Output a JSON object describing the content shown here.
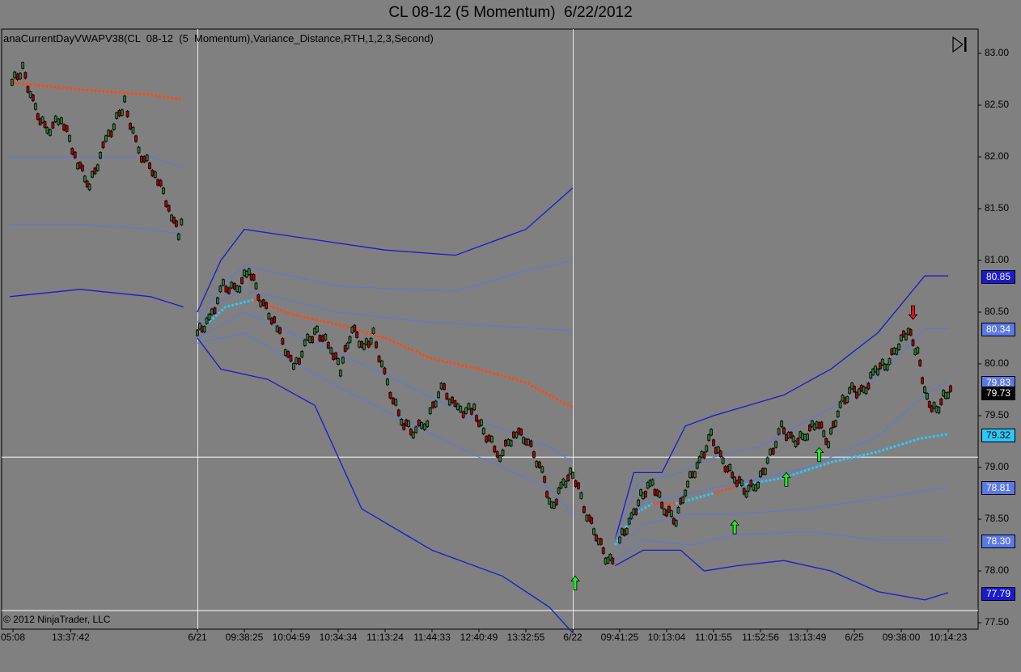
{
  "title": "CL 08-12 (5 Momentum)  6/22/2012",
  "indicator_label": "anaCurrentDayVWAPV38(CL  08-12  (5  Momentum),Variance_Distance,RTH,1,2,3,Second)",
  "copyright": "© 2012 NinjaTrader, LLC",
  "toolbar": {
    "play_icon": "skip-to-end-icon"
  },
  "colors": {
    "background": "#808080",
    "band_outer": "#1a1ad0",
    "band_inner": "#5a78e6",
    "vwap_down": "#ff4a10",
    "vwap_up": "#2ac8ff",
    "candle_up": "#2e7d32",
    "candle_down": "#b00000",
    "arrow_up": "#22ee22",
    "arrow_down": "#dd1111"
  },
  "chart_data": {
    "type": "candlestick",
    "symbol": "CL 08-12",
    "yaxis": {
      "ticks": [
        "83.00",
        "82.50",
        "82.00",
        "81.50",
        "81.00",
        "80.50",
        "80.00",
        "79.50",
        "79.00",
        "78.50",
        "78.00",
        "77.50"
      ],
      "range": [
        77.5,
        83.2
      ]
    },
    "xaxis": {
      "ticks": [
        "05:08",
        "13:37:42",
        "6/21",
        "09:38:25",
        "10:04:59",
        "10:34:34",
        "11:13:24",
        "11:44:33",
        "12:40:49",
        "13:32:55",
        "6/22",
        "09:41:25",
        "10:13:04",
        "11:01:55",
        "11:52:56",
        "13:13:49",
        "6/25",
        "09:38:00",
        "10:14:23"
      ],
      "tick_pos": [
        0.0,
        1.3,
        4.0,
        5.0,
        6.0,
        7.0,
        8.0,
        9.0,
        10.0,
        11.0,
        12.0,
        13.0,
        14.0,
        15.0,
        16.0,
        17.0,
        18.0,
        19.0,
        20.0
      ]
    },
    "price_badges": [
      {
        "label": "80.85",
        "value": 80.85,
        "style": "outer"
      },
      {
        "label": "80.34",
        "value": 80.34,
        "style": "inner"
      },
      {
        "label": "79.83",
        "value": 79.83,
        "style": "inner"
      },
      {
        "label": "79.73",
        "value": 79.73,
        "style": "last"
      },
      {
        "label": "79.32",
        "value": 79.32,
        "style": "vwap"
      },
      {
        "label": "78.81",
        "value": 78.81,
        "style": "inner"
      },
      {
        "label": "78.30",
        "value": 78.3,
        "style": "inner"
      },
      {
        "label": "77.79",
        "value": 77.79,
        "style": "outer"
      }
    ],
    "crosshair": {
      "x": 12.0,
      "y": 79.1
    },
    "session_dividers": [
      4.0,
      12.0
    ],
    "price_path": [
      {
        "segment": 1,
        "points": [
          [
            0.05,
            82.72
          ],
          [
            0.28,
            82.85
          ],
          [
            0.55,
            82.45
          ],
          [
            0.8,
            82.25
          ],
          [
            1.1,
            82.38
          ],
          [
            1.45,
            81.95
          ],
          [
            1.7,
            81.72
          ],
          [
            2.05,
            82.15
          ],
          [
            2.45,
            82.52
          ],
          [
            2.75,
            82.05
          ],
          [
            3.1,
            81.85
          ],
          [
            3.45,
            81.45
          ],
          [
            3.6,
            81.25
          ],
          [
            3.72,
            81.42
          ]
        ]
      },
      {
        "segment": 2,
        "points": [
          [
            4.0,
            80.3
          ],
          [
            4.25,
            80.42
          ],
          [
            4.55,
            80.75
          ],
          [
            4.85,
            80.72
          ],
          [
            5.1,
            80.92
          ],
          [
            5.35,
            80.62
          ],
          [
            5.7,
            80.35
          ],
          [
            6.05,
            79.95
          ],
          [
            6.35,
            80.22
          ],
          [
            6.55,
            80.32
          ],
          [
            6.85,
            80.15
          ],
          [
            7.05,
            79.95
          ],
          [
            7.3,
            80.35
          ],
          [
            7.55,
            80.15
          ],
          [
            7.75,
            80.28
          ],
          [
            8.05,
            79.8
          ],
          [
            8.35,
            79.45
          ],
          [
            8.6,
            79.35
          ],
          [
            8.9,
            79.45
          ],
          [
            9.2,
            79.78
          ],
          [
            9.55,
            79.55
          ],
          [
            9.9,
            79.55
          ],
          [
            10.1,
            79.35
          ],
          [
            10.45,
            79.12
          ],
          [
            10.8,
            79.35
          ],
          [
            11.05,
            79.25
          ],
          [
            11.35,
            78.95
          ],
          [
            11.55,
            78.6
          ],
          [
            11.8,
            78.85
          ],
          [
            12.0,
            78.95
          ],
          [
            12.3,
            78.55
          ],
          [
            12.55,
            78.3
          ],
          [
            12.75,
            78.08
          ],
          [
            12.9,
            78.15
          ]
        ]
      },
      {
        "segment": 3,
        "points": [
          [
            13.0,
            78.3
          ],
          [
            13.25,
            78.5
          ],
          [
            13.45,
            78.72
          ],
          [
            13.7,
            78.85
          ],
          [
            13.95,
            78.6
          ],
          [
            14.2,
            78.5
          ],
          [
            14.45,
            78.85
          ],
          [
            14.7,
            79.05
          ],
          [
            14.95,
            79.3
          ],
          [
            15.2,
            79.05
          ],
          [
            15.45,
            78.9
          ],
          [
            15.7,
            78.78
          ],
          [
            15.95,
            78.85
          ],
          [
            16.15,
            79.05
          ],
          [
            16.45,
            79.38
          ],
          [
            16.7,
            79.25
          ],
          [
            16.95,
            79.3
          ],
          [
            17.2,
            79.45
          ],
          [
            17.45,
            79.25
          ],
          [
            17.7,
            79.6
          ],
          [
            17.95,
            79.75
          ],
          [
            18.2,
            79.72
          ],
          [
            18.45,
            79.95
          ],
          [
            18.7,
            80.0
          ],
          [
            18.95,
            80.2
          ],
          [
            19.15,
            80.32
          ],
          [
            19.35,
            80.1
          ],
          [
            19.55,
            79.65
          ],
          [
            19.75,
            79.55
          ],
          [
            19.95,
            79.72
          ],
          [
            20.1,
            79.73
          ]
        ]
      }
    ],
    "bands": [
      {
        "name": "s1_upper_outer",
        "style": "outer",
        "points": [
          [
            4.0,
            80.5
          ],
          [
            4.5,
            81.0
          ],
          [
            5.0,
            81.3
          ],
          [
            6.5,
            81.2
          ],
          [
            8.0,
            81.1
          ],
          [
            9.5,
            81.05
          ],
          [
            11.0,
            81.3
          ],
          [
            12.0,
            81.7
          ]
        ]
      },
      {
        "name": "s1_upper_inner",
        "style": "inner",
        "points": [
          [
            4.0,
            80.4
          ],
          [
            4.5,
            80.75
          ],
          [
            5.0,
            80.95
          ],
          [
            7.0,
            80.75
          ],
          [
            9.5,
            80.7
          ],
          [
            11.0,
            80.9
          ],
          [
            12.0,
            81.0
          ]
        ]
      },
      {
        "name": "s1_mid_inner",
        "style": "inner",
        "points": [
          [
            4.0,
            80.35
          ],
          [
            4.5,
            80.6
          ],
          [
            5.0,
            80.72
          ],
          [
            7.0,
            80.5
          ],
          [
            9.0,
            80.4
          ],
          [
            11.0,
            80.35
          ],
          [
            12.0,
            80.32
          ]
        ]
      },
      {
        "name": "s1_low_inner1",
        "style": "inner",
        "points": [
          [
            4.0,
            80.25
          ],
          [
            5.0,
            80.5
          ],
          [
            6.5,
            80.2
          ],
          [
            8.0,
            79.9
          ],
          [
            10.0,
            79.45
          ],
          [
            11.5,
            79.2
          ],
          [
            12.0,
            79.05
          ]
        ]
      },
      {
        "name": "s1_low_inner2",
        "style": "inner",
        "points": [
          [
            4.0,
            80.2
          ],
          [
            5.0,
            80.3
          ],
          [
            6.5,
            79.9
          ],
          [
            8.0,
            79.55
          ],
          [
            10.0,
            79.1
          ],
          [
            11.5,
            78.8
          ],
          [
            12.0,
            78.55
          ]
        ]
      },
      {
        "name": "s1_lower_outer",
        "style": "outer",
        "points": [
          [
            4.0,
            80.25
          ],
          [
            4.5,
            79.95
          ],
          [
            5.5,
            79.85
          ],
          [
            6.5,
            79.6
          ],
          [
            7.5,
            78.6
          ],
          [
            9.0,
            78.2
          ],
          [
            10.5,
            77.95
          ],
          [
            11.5,
            77.65
          ],
          [
            12.0,
            77.4
          ]
        ]
      },
      {
        "name": "s0_upper",
        "style": "inner",
        "points": [
          [
            0.0,
            82.0
          ],
          [
            1.5,
            82.0
          ],
          [
            3.0,
            82.0
          ],
          [
            3.7,
            81.9
          ]
        ]
      },
      {
        "name": "s0_lower",
        "style": "inner",
        "points": [
          [
            0.0,
            81.35
          ],
          [
            1.5,
            81.35
          ],
          [
            3.0,
            81.3
          ],
          [
            3.7,
            81.25
          ]
        ]
      },
      {
        "name": "s0_outer_lower",
        "style": "outer",
        "points": [
          [
            0.0,
            80.65
          ],
          [
            1.5,
            80.72
          ],
          [
            3.0,
            80.65
          ],
          [
            3.7,
            80.55
          ]
        ]
      },
      {
        "name": "s3_upper_outer",
        "style": "outer",
        "points": [
          [
            12.9,
            78.3
          ],
          [
            13.3,
            78.95
          ],
          [
            13.9,
            78.95
          ],
          [
            14.4,
            79.4
          ],
          [
            15.0,
            79.5
          ],
          [
            16.5,
            79.7
          ],
          [
            17.5,
            79.95
          ],
          [
            18.5,
            80.3
          ],
          [
            19.5,
            80.85
          ],
          [
            20.0,
            80.85
          ]
        ]
      },
      {
        "name": "s3_upper_inner",
        "style": "inner",
        "points": [
          [
            12.9,
            78.3
          ],
          [
            13.4,
            78.85
          ],
          [
            14.3,
            78.95
          ],
          [
            15.0,
            79.1
          ],
          [
            16.0,
            79.2
          ],
          [
            17.0,
            79.45
          ],
          [
            18.0,
            79.7
          ],
          [
            19.0,
            80.1
          ],
          [
            19.5,
            80.34
          ],
          [
            20.0,
            80.34
          ]
        ]
      },
      {
        "name": "s3_mid_inner",
        "style": "inner",
        "points": [
          [
            12.9,
            78.25
          ],
          [
            13.5,
            78.65
          ],
          [
            14.5,
            78.75
          ],
          [
            15.5,
            78.85
          ],
          [
            17.0,
            79.0
          ],
          [
            18.5,
            79.3
          ],
          [
            19.5,
            79.7
          ],
          [
            20.0,
            79.83
          ]
        ]
      },
      {
        "name": "s3_low_inner1",
        "style": "inner",
        "points": [
          [
            12.9,
            78.2
          ],
          [
            13.5,
            78.45
          ],
          [
            14.5,
            78.55
          ],
          [
            15.5,
            78.55
          ],
          [
            17.0,
            78.6
          ],
          [
            18.5,
            78.7
          ],
          [
            20.0,
            78.81
          ]
        ]
      },
      {
        "name": "s3_low_inner2",
        "style": "inner",
        "points": [
          [
            12.9,
            78.1
          ],
          [
            13.5,
            78.3
          ],
          [
            14.5,
            78.25
          ],
          [
            15.5,
            78.35
          ],
          [
            17.0,
            78.38
          ],
          [
            18.5,
            78.3
          ],
          [
            20.0,
            78.3
          ]
        ]
      },
      {
        "name": "s3_lower_outer",
        "style": "outer",
        "points": [
          [
            12.9,
            78.05
          ],
          [
            13.5,
            78.2
          ],
          [
            14.3,
            78.2
          ],
          [
            14.8,
            78.0
          ],
          [
            15.5,
            78.05
          ],
          [
            16.5,
            78.1
          ],
          [
            17.5,
            78.0
          ],
          [
            18.5,
            77.8
          ],
          [
            19.5,
            77.72
          ],
          [
            20.0,
            77.79
          ]
        ]
      }
    ],
    "vwap": [
      {
        "trend": "down",
        "points": [
          [
            0.0,
            82.72
          ],
          [
            1.5,
            82.65
          ],
          [
            3.0,
            82.6
          ],
          [
            3.7,
            82.55
          ]
        ]
      },
      {
        "trend": "up",
        "points": [
          [
            4.0,
            80.3
          ],
          [
            4.6,
            80.55
          ],
          [
            5.2,
            80.62
          ]
        ]
      },
      {
        "trend": "down",
        "points": [
          [
            5.2,
            80.62
          ],
          [
            6.0,
            80.48
          ],
          [
            7.0,
            80.38
          ],
          [
            8.0,
            80.25
          ],
          [
            9.0,
            80.05
          ],
          [
            10.0,
            79.95
          ],
          [
            11.0,
            79.82
          ],
          [
            12.0,
            79.58
          ]
        ]
      },
      {
        "trend": "up",
        "points": [
          [
            12.9,
            78.25
          ],
          [
            13.3,
            78.55
          ],
          [
            13.7,
            78.65
          ]
        ]
      },
      {
        "trend": "down",
        "points": [
          [
            13.7,
            78.65
          ],
          [
            14.2,
            78.65
          ]
        ]
      },
      {
        "trend": "up",
        "points": [
          [
            14.2,
            78.65
          ],
          [
            15.0,
            78.75
          ]
        ]
      },
      {
        "trend": "down",
        "points": [
          [
            15.0,
            78.75
          ],
          [
            15.5,
            78.82
          ]
        ]
      },
      {
        "trend": "up",
        "points": [
          [
            15.5,
            78.82
          ],
          [
            16.5,
            78.9
          ],
          [
            17.5,
            79.05
          ],
          [
            18.5,
            79.15
          ],
          [
            19.4,
            79.28
          ],
          [
            20.0,
            79.32
          ]
        ]
      }
    ],
    "signals": [
      {
        "dir": "up",
        "x": 12.05,
        "y": 77.88
      },
      {
        "dir": "up",
        "x": 15.45,
        "y": 78.42
      },
      {
        "dir": "up",
        "x": 16.55,
        "y": 78.88
      },
      {
        "dir": "up",
        "x": 17.25,
        "y": 79.12
      },
      {
        "dir": "down",
        "x": 19.25,
        "y": 80.5
      }
    ]
  }
}
